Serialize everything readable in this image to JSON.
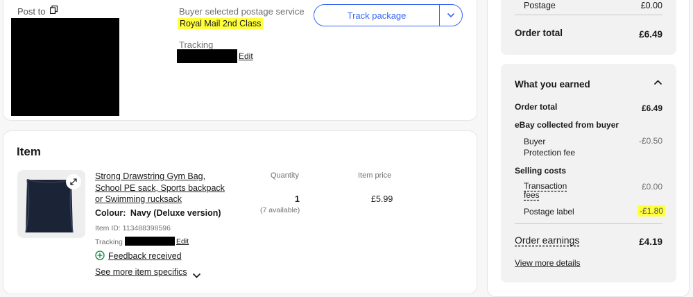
{
  "shipping": {
    "post_to_label": "Post to",
    "service_label": "Buyer selected postage service",
    "service_value": "Royal Mail 2nd Class",
    "tracking_label": "Tracking",
    "edit_label": "Edit",
    "track_button": "Track package"
  },
  "item": {
    "section_title": "Item",
    "title": "Strong Drawstring Gym Bag, School PE sack, Sports backpack or Swimming rucksack",
    "title_line1": "Strong Drawstring Gym Bag,",
    "title_line2": "School PE sack, Sports backpack",
    "title_line3": "or Swimming rucksack",
    "colour_label": "Colour:",
    "colour_value": "Navy (Deluxe version)",
    "item_id": "Item ID: 113488398596",
    "tracking_label": "Tracking",
    "edit_label": "Edit",
    "feedback": "Feedback received",
    "see_more": "See more item specifics",
    "quantity_header": "Quantity",
    "quantity_value": "1",
    "available": "(7 available)",
    "price_header": "Item price",
    "price_value": "£5.99"
  },
  "order_summary": {
    "postage_label": "Postage",
    "postage_value": "£0.00",
    "order_total_label": "Order total",
    "order_total_value": "£6.49"
  },
  "earnings": {
    "title": "What you earned",
    "order_total_label": "Order total",
    "order_total_value": "£6.49",
    "collected_label": "eBay collected from buyer",
    "bpf_label_line1": "Buyer",
    "bpf_label_line2": "Protection fee",
    "bpf_value": "-£0.50",
    "selling_costs_label": "Selling costs",
    "transaction_label_line1": "Transaction",
    "transaction_label_line2": "fees",
    "transaction_value": "£0.00",
    "postage_label_label": "Postage label",
    "postage_label_value": "-£1.80",
    "order_earnings_label": "Order earnings",
    "order_earnings_value": "£4.19",
    "view_more": "View more details"
  },
  "colors": {
    "accent": "#3665f3",
    "highlight": "#ffff3c",
    "feedback_green": "#05823f"
  }
}
